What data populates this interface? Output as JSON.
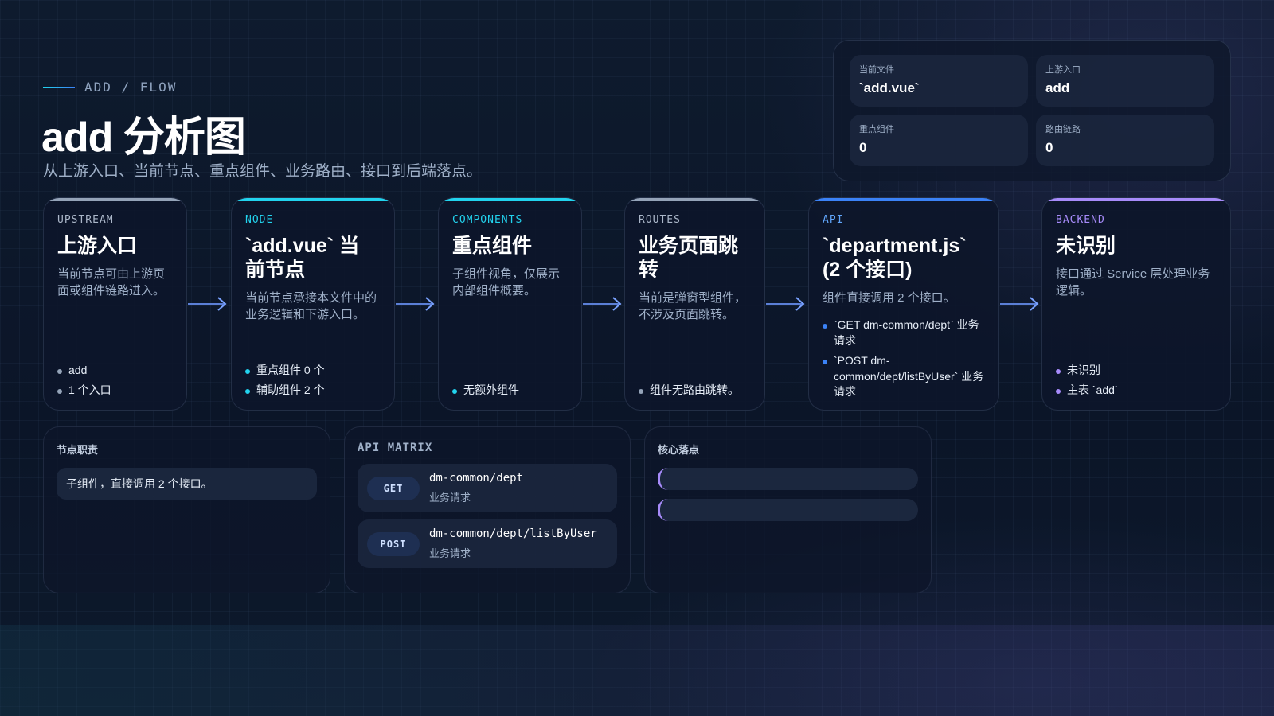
{
  "header": {
    "eyebrow": "ADD / FLOW",
    "title": "add 分析图",
    "subtitle": "从上游入口、当前节点、重点组件、业务路由、接口到后端落点。"
  },
  "stats": [
    {
      "label": "当前文件",
      "value": "`add.vue`"
    },
    {
      "label": "上游入口",
      "value": "add"
    },
    {
      "label": "重点组件",
      "value": "0"
    },
    {
      "label": "路由链路",
      "value": "0"
    }
  ],
  "cards": {
    "upstream": {
      "tag": "UPSTREAM",
      "title": "上游入口",
      "desc": "当前节点可由上游页面或组件链路进入。",
      "items": [
        "add",
        "1 个入口"
      ],
      "color": "#94a3b8"
    },
    "node": {
      "tag": "NODE",
      "title": "`add.vue` 当前节点",
      "desc": "当前节点承接本文件中的业务逻辑和下游入口。",
      "items": [
        "重点组件 0 个",
        "辅助组件 2 个"
      ],
      "color": "#22d3ee"
    },
    "components": {
      "tag": "COMPONENTS",
      "title": "重点组件",
      "desc": "子组件视角，仅展示内部组件概要。",
      "items": [
        "无额外组件"
      ],
      "color": "#22d3ee"
    },
    "routes": {
      "tag": "ROUTES",
      "title": "业务页面跳转",
      "desc": "当前是弹窗型组件，不涉及页面跳转。",
      "items": [
        "组件无路由跳转。"
      ],
      "color": "#94a3b8"
    },
    "api": {
      "tag": "API",
      "title": "`department.js` (2 个接口)",
      "desc": "组件直接调用 2 个接口。",
      "items": [
        "`GET dm-common/dept` 业务请求",
        "`POST dm-common/dept/listByUser` 业务请求"
      ],
      "color": "#3b82f6"
    },
    "backend": {
      "tag": "BACKEND",
      "title": "未识别",
      "desc": "接口通过 Service 层处理业务逻辑。",
      "items": [
        "未识别",
        "主表 `add`"
      ],
      "color": "#a78bfa"
    }
  },
  "panels": {
    "responsibility": {
      "title": "节点职责",
      "text": "子组件，直接调用 2 个接口。"
    },
    "api_matrix": {
      "title": "API MATRIX",
      "rows": [
        {
          "method": "GET",
          "path": "dm-common/dept",
          "note": "业务请求"
        },
        {
          "method": "POST",
          "path": "dm-common/dept/listByUser",
          "note": "业务请求"
        }
      ]
    },
    "core": {
      "title": "核心落点"
    }
  }
}
